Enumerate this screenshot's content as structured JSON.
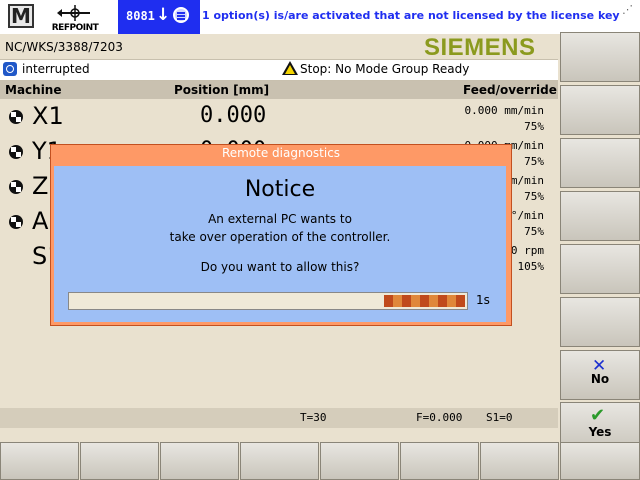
{
  "header": {
    "mode_icon": "M",
    "refpoint_label": "REFPOINT",
    "alarm_number": "8081",
    "alarm_text": "1 option(s) is/are activated that are not licensed by the license key"
  },
  "path": "NC/WKS/3388/7203",
  "brand": "SIEMENS",
  "status": {
    "channel_state": "interrupted",
    "program_status": "Stop: No Mode Group Ready"
  },
  "table": {
    "headers": {
      "machine": "Machine",
      "position": "Position [mm]",
      "feed": "Feed/override"
    },
    "rows": [
      {
        "axis": "X1",
        "position": "0.000",
        "feed": "0.000 mm/min",
        "override": "75%"
      },
      {
        "axis": "Y1",
        "position": "0.000",
        "feed": "0.000 mm/min",
        "override": "75%"
      },
      {
        "axis": "Z1",
        "position": "",
        "feed": "m/min",
        "override": "75%"
      },
      {
        "axis": "A1",
        "position": "",
        "feed": "°/min",
        "override": "75%"
      },
      {
        "axis": "S1",
        "position": "",
        "feed": "0 rpm",
        "override": "105%"
      }
    ]
  },
  "info_row": {
    "tool": "T=30",
    "feed": "F=0.000",
    "spindle": "S1=0"
  },
  "softkeys": {
    "no": "No",
    "yes": "Yes"
  },
  "dialog": {
    "title": "Remote diagnostics",
    "heading": "Notice",
    "line1": "An external PC wants to",
    "line2": "take over operation of the controller.",
    "question": "Do you want to allow this?",
    "remaining": "1s",
    "progress_segments": 9,
    "seg_colors": [
      "#c04a1c",
      "#e0873a"
    ]
  },
  "colors": {
    "alarm_blue": "#1f2ef0",
    "siemens": "#8b9a1e",
    "dialog_frame": "#fe9966",
    "dialog_body": "#9ebff5"
  }
}
